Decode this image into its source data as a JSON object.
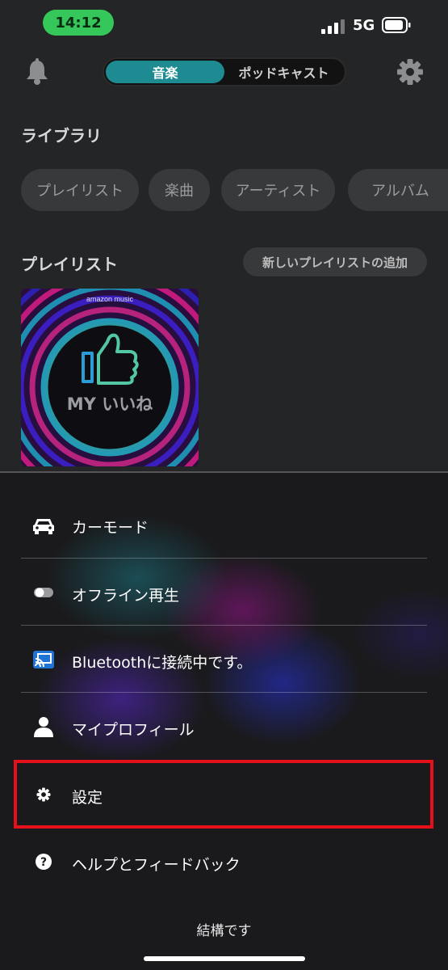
{
  "status_bar": {
    "time": "14:12",
    "network": "5G"
  },
  "header": {
    "tabs": [
      {
        "label": "音楽",
        "active": true
      },
      {
        "label": "ポッドキャスト",
        "active": false
      }
    ],
    "accent_color": "#1d8b91"
  },
  "library": {
    "title": "ライブラリ",
    "filters": [
      "プレイリスト",
      "楽曲",
      "アーティスト",
      "アルバム"
    ]
  },
  "playlists": {
    "title": "プレイリスト",
    "add_button": "新しいプレイリストの追加",
    "cover": {
      "brand": "amazon music",
      "name": "MY いいね"
    }
  },
  "menu": {
    "items": [
      {
        "label": "カーモード",
        "icon": "car-icon"
      },
      {
        "label": "オフライン再生",
        "icon": "toggle-icon"
      },
      {
        "label": "Bluetoothに接続中です。",
        "icon": "cast-icon"
      },
      {
        "label": "マイプロフィール",
        "icon": "person-icon"
      },
      {
        "label": "設定",
        "icon": "gear-icon"
      },
      {
        "label": "ヘルプとフィードバック",
        "icon": "help-icon"
      }
    ],
    "highlight_color": "#e5101a"
  },
  "footer": {
    "dismiss_label": "結構です"
  }
}
